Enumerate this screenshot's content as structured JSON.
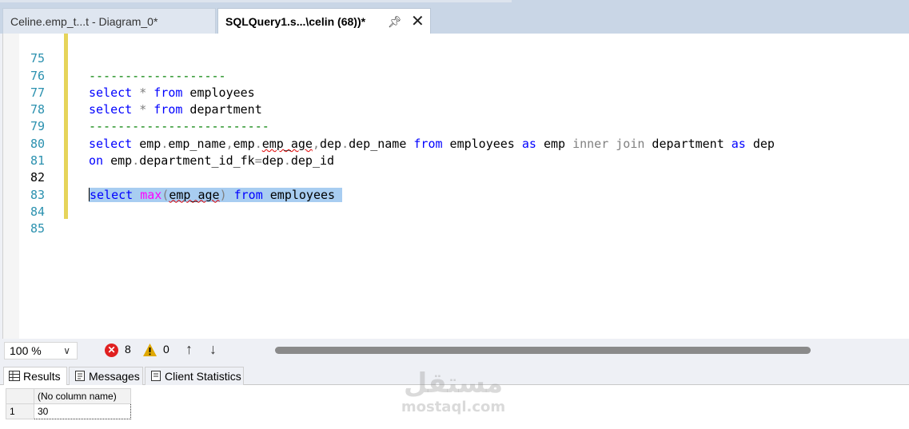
{
  "tabs": {
    "inactive_label": "Celine.emp_t...t - Diagram_0*",
    "active_label": "SQLQuery1.s...\\celin (68))*"
  },
  "editor": {
    "line_numbers": [
      "75",
      "76",
      "77",
      "78",
      "79",
      "80",
      "81",
      "82",
      "83",
      "84",
      "85"
    ],
    "lines": {
      "l75": "-------------------",
      "l76": [
        "select",
        " * ",
        "from",
        " employees"
      ],
      "l77": [
        "select",
        " * ",
        "from",
        " department"
      ],
      "l78": "-------------------------",
      "l79": [
        "select",
        " emp",
        ".",
        "emp_name",
        ",",
        "emp",
        ".",
        "emp_age",
        ",",
        "dep",
        ".",
        "dep_name ",
        "from",
        " employees ",
        "as",
        " emp ",
        "inner join",
        " department ",
        "as",
        " dep"
      ],
      "l80": [
        "on",
        " emp",
        ".",
        "department_id_fk",
        "=",
        "dep",
        ".",
        "dep_id"
      ],
      "l82": [
        "select",
        " ",
        "max",
        "(",
        "emp_age",
        ")",
        " ",
        "from",
        " employees"
      ]
    },
    "current_line": "82"
  },
  "status": {
    "zoom": "100 %",
    "error_count": "8",
    "warning_count": "0"
  },
  "result_tabs": {
    "results": "Results",
    "messages": "Messages",
    "client_statistics": "Client Statistics"
  },
  "grid": {
    "column_header": "(No column name)",
    "rows": [
      {
        "row_number": "1",
        "value": "30"
      }
    ]
  },
  "watermark": {
    "arabic": "مستقل",
    "latin": "mostaql.com"
  },
  "colors": {
    "keyword": "#0000ff",
    "function": "#ff00ff",
    "operator": "#808080",
    "comment": "#008000",
    "line_number": "#2b91af",
    "selection": "#a8cdf1",
    "error": "#e02020"
  }
}
